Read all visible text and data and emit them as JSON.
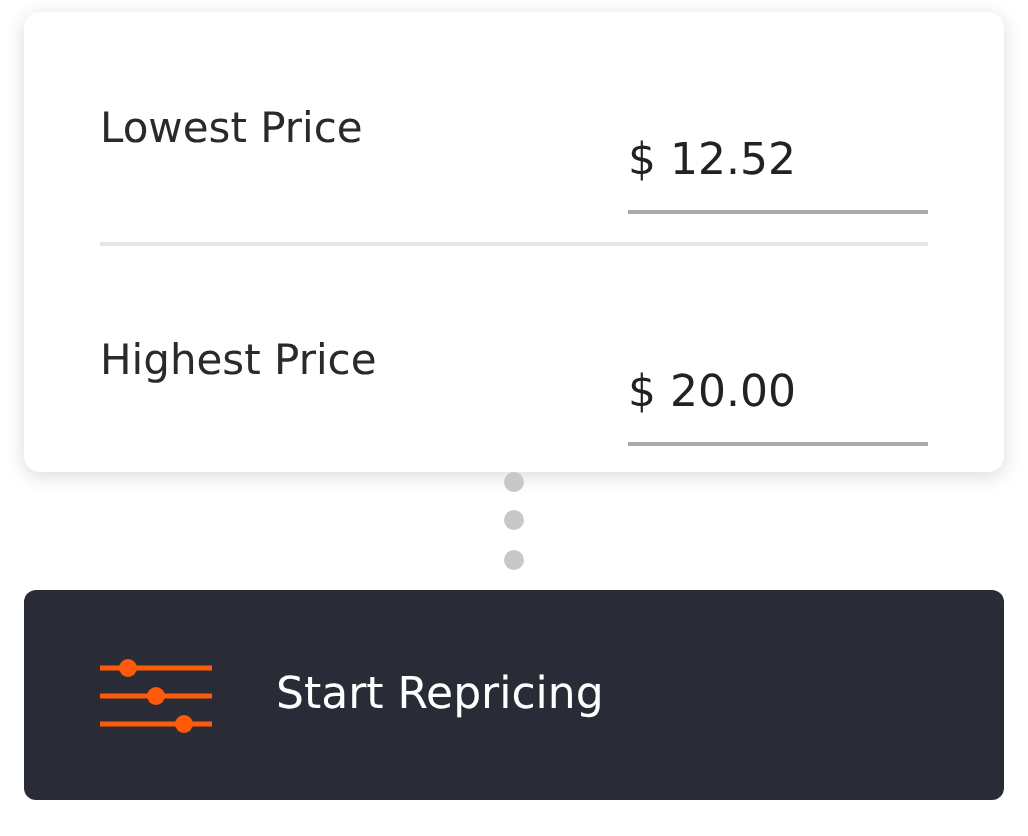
{
  "price_range": [
    {
      "label": "Lowest Price",
      "value": "$ 12.52"
    },
    {
      "label": "Highest Price",
      "value": "$ 20.00"
    }
  ],
  "action_button": {
    "label": "Start Repricing"
  }
}
